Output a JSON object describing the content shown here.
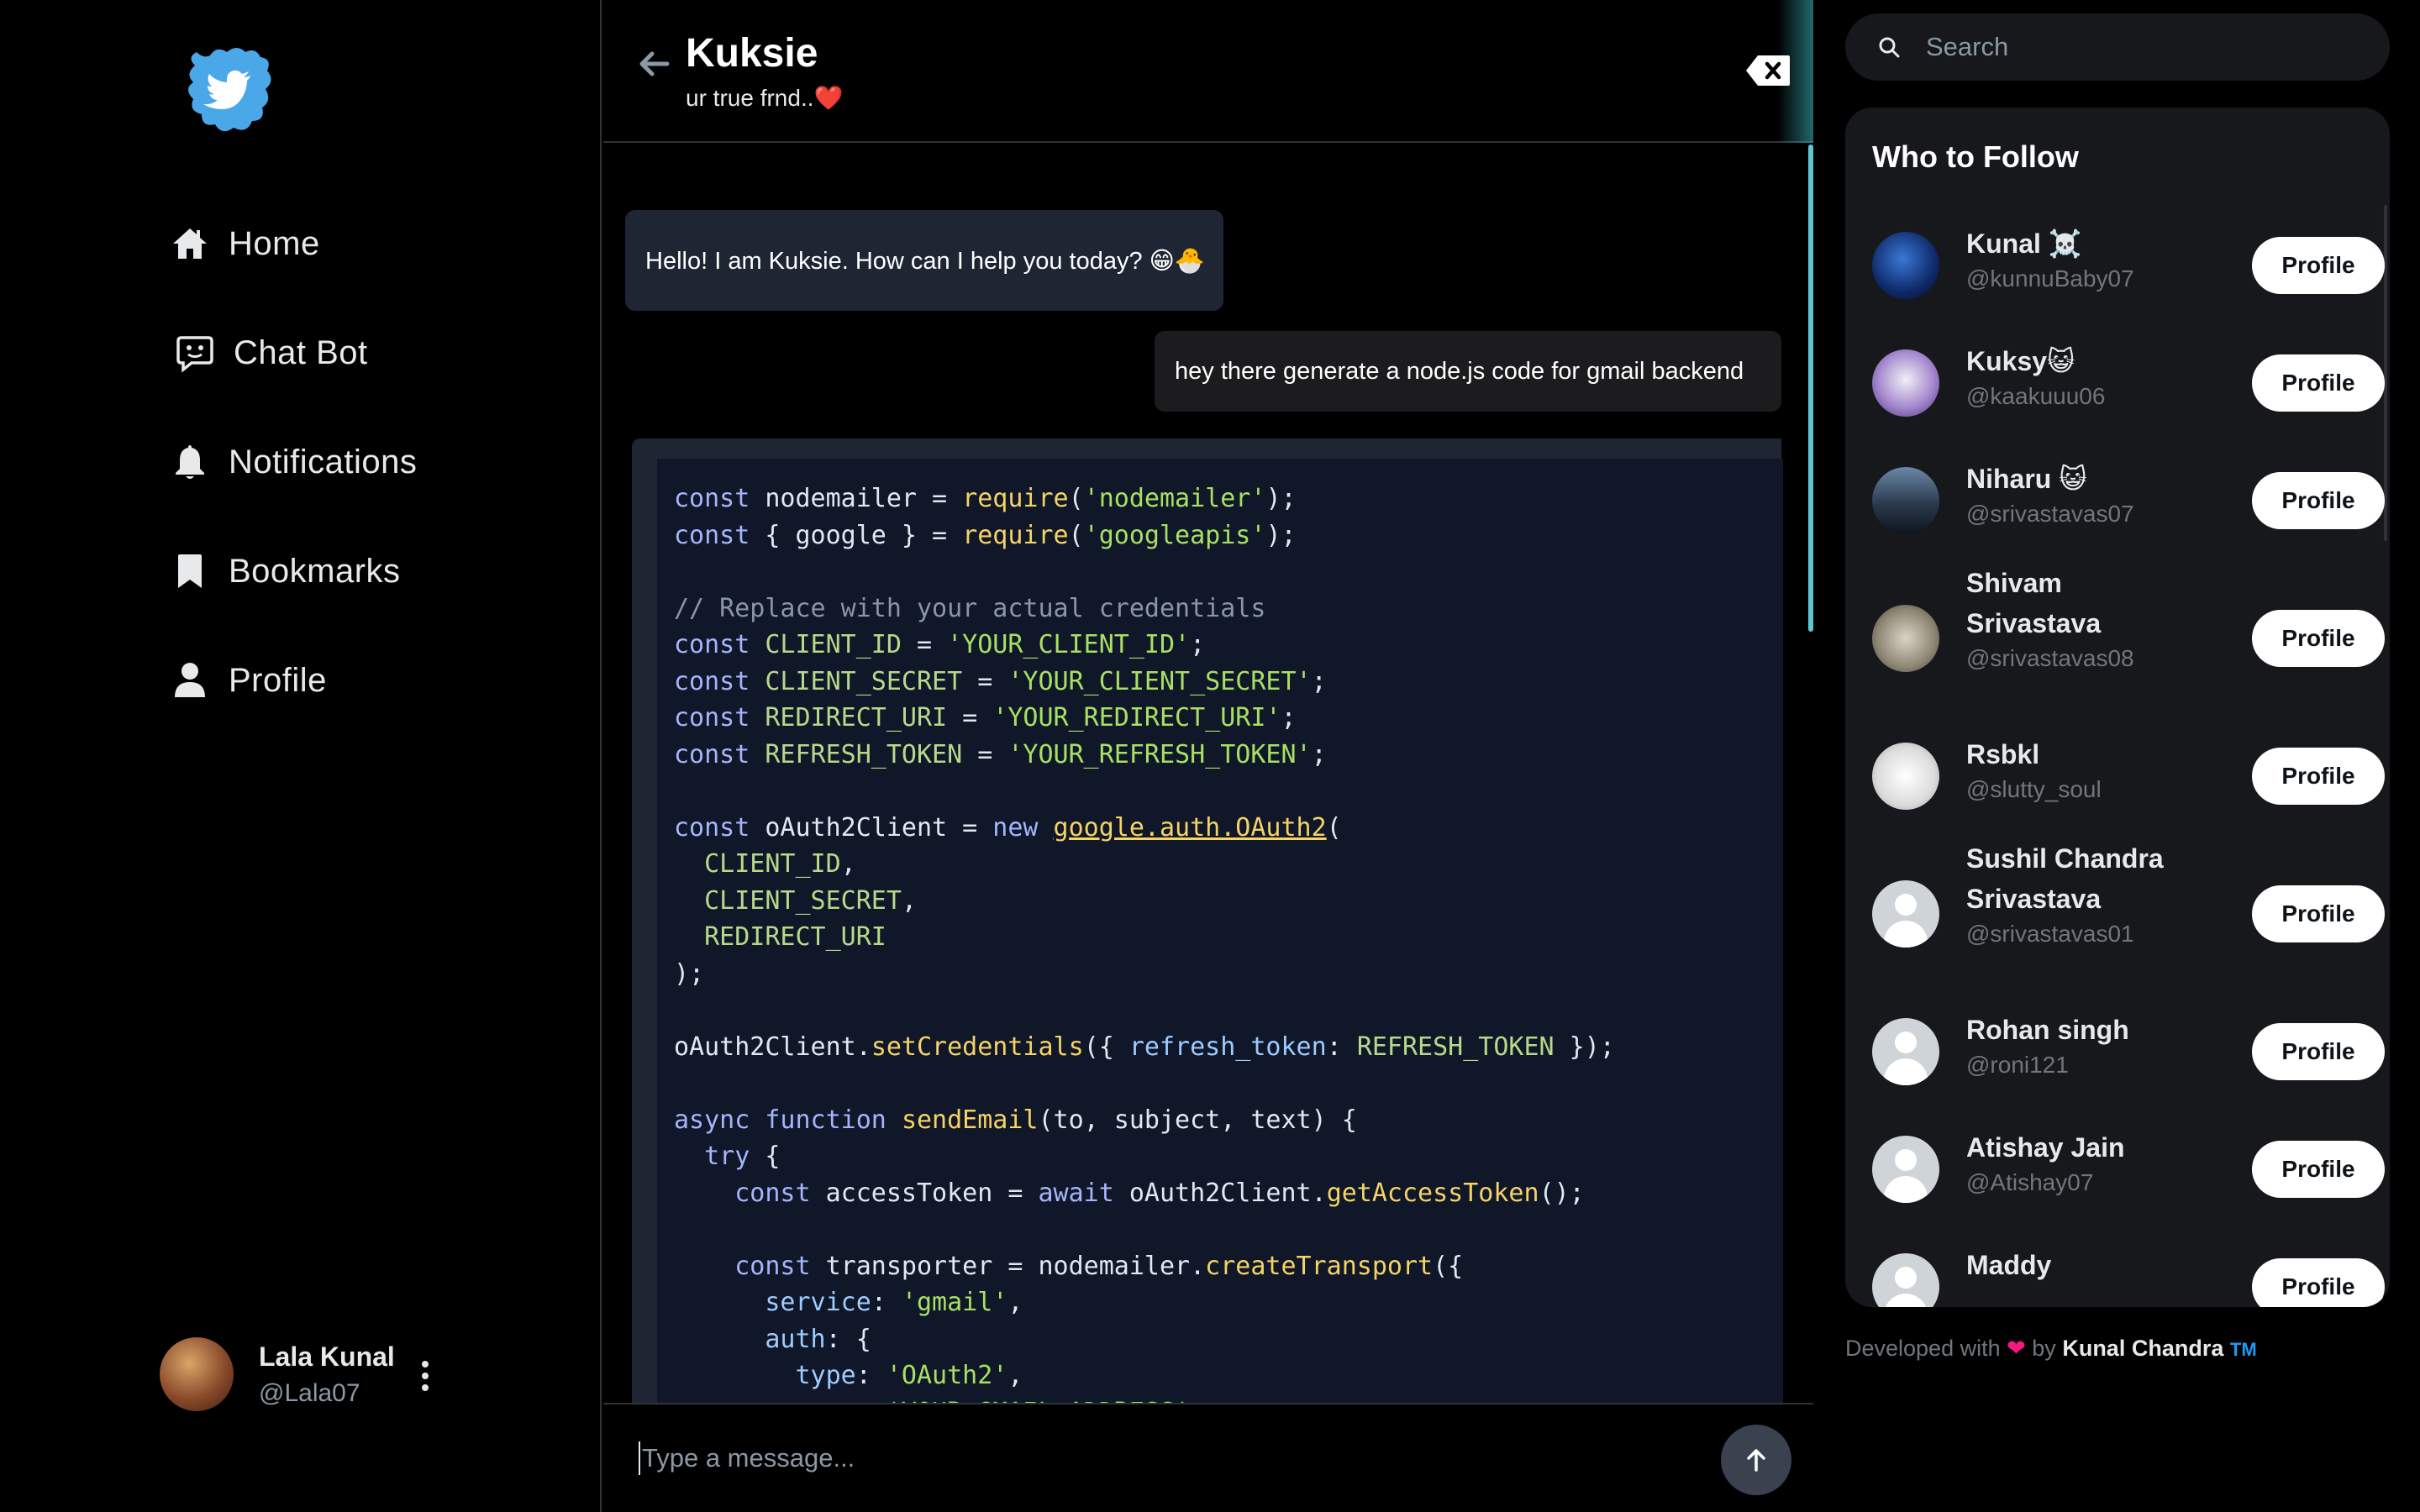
{
  "nav": {
    "items": [
      {
        "label": "Home",
        "icon": "home-icon"
      },
      {
        "label": "Chat Bot",
        "icon": "chat-bot-icon"
      },
      {
        "label": "Notifications",
        "icon": "bell-icon"
      },
      {
        "label": "Bookmarks",
        "icon": "bookmark-icon"
      },
      {
        "label": "Profile",
        "icon": "person-icon"
      }
    ]
  },
  "current_user": {
    "name": "Lala Kunal",
    "handle": "@Lala07"
  },
  "chat": {
    "title": "Kuksie",
    "subtitle": "ur true frnd..❤️",
    "messages": [
      {
        "role": "bot",
        "text": "Hello! I am Kuksie. How can I help you today? 😁🐣"
      },
      {
        "role": "user",
        "text": "hey there generate a node.js code for gmail backend"
      }
    ],
    "code_lines": [
      "const nodemailer = require('nodemailer');",
      "const { google } = require('googleapis');",
      "",
      "// Replace with your actual credentials",
      "const CLIENT_ID = 'YOUR_CLIENT_ID';",
      "const CLIENT_SECRET = 'YOUR_CLIENT_SECRET';",
      "const REDIRECT_URI = 'YOUR_REDIRECT_URI';",
      "const REFRESH_TOKEN = 'YOUR_REFRESH_TOKEN';",
      "",
      "const oAuth2Client = new google.auth.OAuth2(",
      "  CLIENT_ID,",
      "  CLIENT_SECRET,",
      "  REDIRECT_URI",
      ");",
      "",
      "oAuth2Client.setCredentials({ refresh_token: REFRESH_TOKEN });",
      "",
      "async function sendEmail(to, subject, text) {",
      "  try {",
      "    const accessToken = await oAuth2Client.getAccessToken();",
      "",
      "    const transporter = nodemailer.createTransport({",
      "      service: 'gmail',",
      "      auth: {",
      "        type: 'OAuth2',",
      "        user: 'YOUR_GMAIL_ADDRESS',"
    ],
    "input_placeholder": "Type a message..."
  },
  "search": {
    "placeholder": "Search"
  },
  "who_to_follow": {
    "title": "Who to Follow",
    "button_label": "Profile",
    "users": [
      {
        "name": "Kunal ☠️",
        "handle": "@kunnuBaby07"
      },
      {
        "name": "Kuksy😺",
        "handle": "@kaakuuu06"
      },
      {
        "name": "Niharu 😺",
        "handle": "@srivastavas07"
      },
      {
        "name": "Shivam Srivastava",
        "handle": "@srivastavas08"
      },
      {
        "name": "Rsbkl",
        "handle": "@slutty_soul"
      },
      {
        "name": "Sushil Chandra Srivastava",
        "handle": "@srivastavas01"
      },
      {
        "name": "Rohan singh",
        "handle": "@roni121"
      },
      {
        "name": "Atishay Jain",
        "handle": "@Atishay07"
      },
      {
        "name": "Maddy",
        "handle": ""
      }
    ]
  },
  "footer": {
    "prefix": "Developed with",
    "by": "by",
    "author": "Kunal Chandra",
    "tm": "TM"
  },
  "colors": {
    "brand": "#1d9bf0",
    "code_bg": "#0f1729",
    "bot_bubble": "#1e2533",
    "accent_glow": "#5ec6d2"
  }
}
